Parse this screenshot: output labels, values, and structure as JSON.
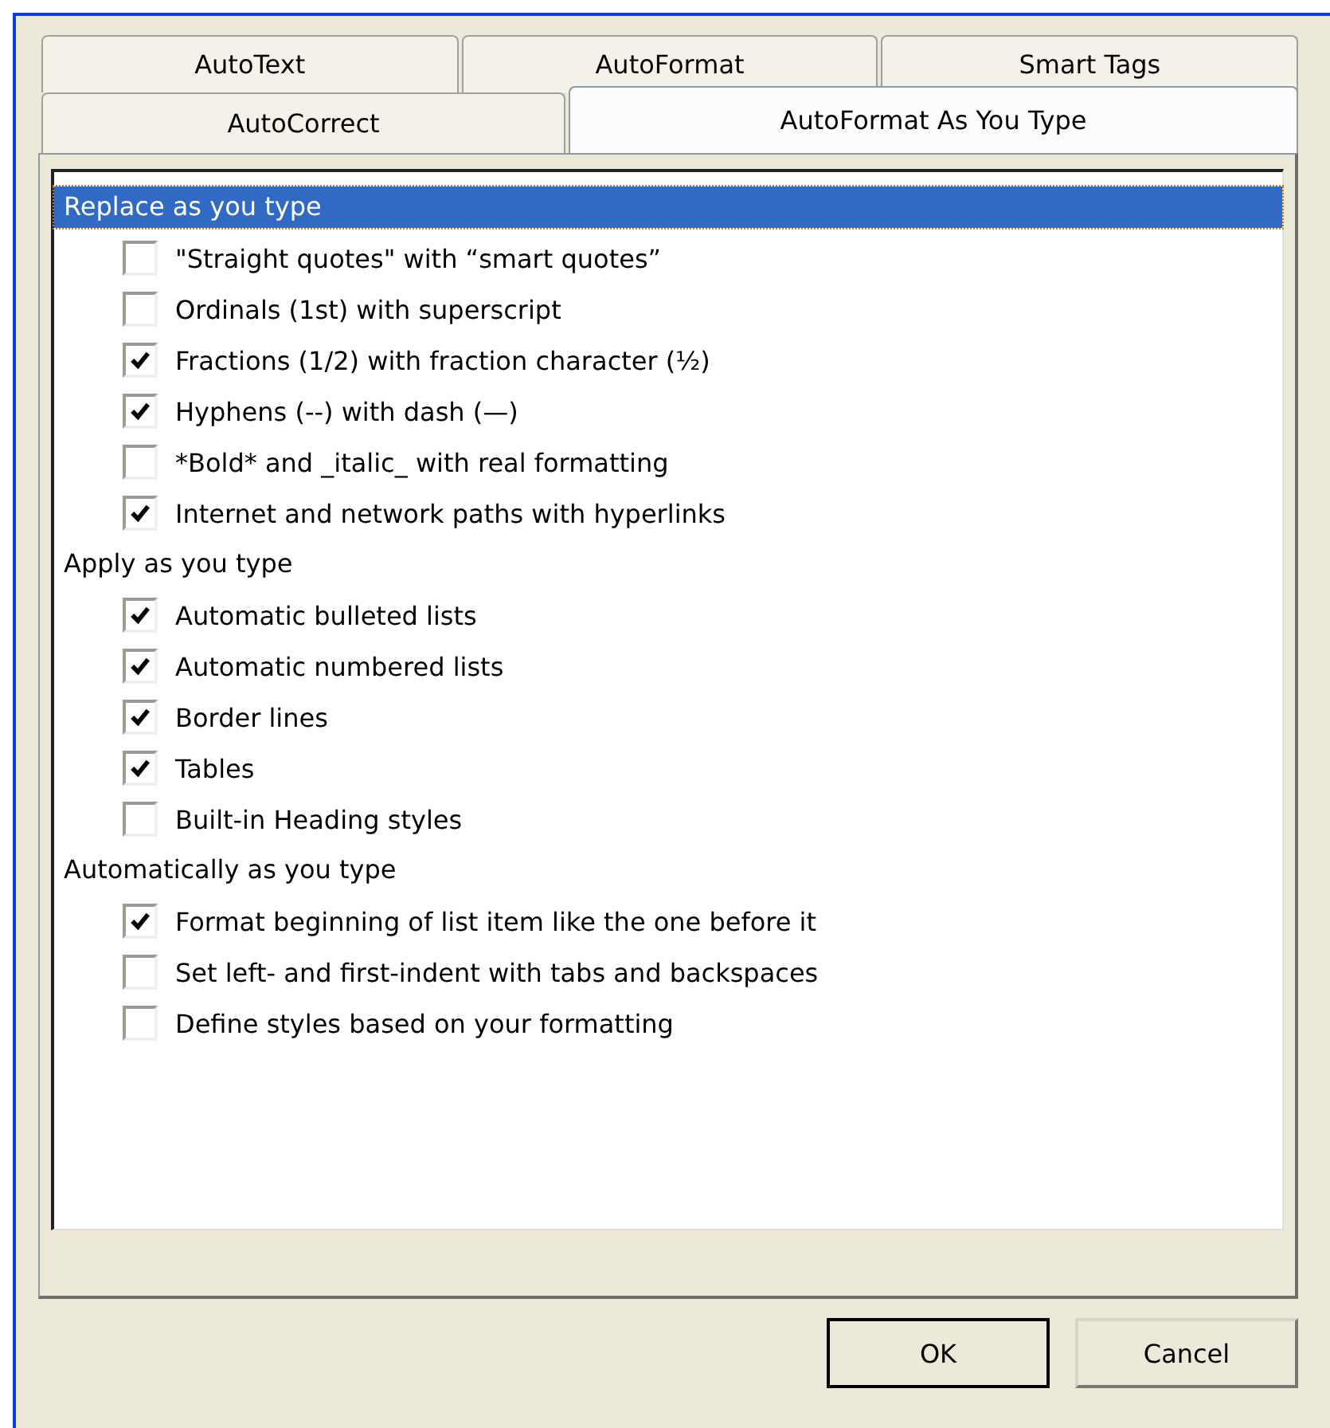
{
  "tab_rows": [
    {
      "tabs": [
        {
          "label": "AutoText",
          "selected": false
        },
        {
          "label": "AutoFormat",
          "selected": false
        },
        {
          "label": "Smart Tags",
          "selected": false
        }
      ]
    },
    {
      "tabs": [
        {
          "label": "AutoCorrect",
          "selected": false
        },
        {
          "label": "AutoFormat As You Type",
          "selected": true
        }
      ]
    }
  ],
  "groups": [
    {
      "heading": "Replace as you type",
      "selected": true,
      "options": [
        {
          "label": "\"Straight quotes\" with “smart quotes”",
          "checked": false
        },
        {
          "label": "Ordinals (1st) with superscript",
          "checked": false
        },
        {
          "label": "Fractions (1/2) with fraction character (½)",
          "checked": true
        },
        {
          "label": "Hyphens (--) with dash (—)",
          "checked": true
        },
        {
          "label": "*Bold* and _italic_ with real formatting",
          "checked": false
        },
        {
          "label": "Internet and network paths with hyperlinks",
          "checked": true
        }
      ]
    },
    {
      "heading": "Apply as you type",
      "selected": false,
      "options": [
        {
          "label": "Automatic bulleted lists",
          "checked": true
        },
        {
          "label": "Automatic numbered lists",
          "checked": true
        },
        {
          "label": "Border lines",
          "checked": true
        },
        {
          "label": "Tables",
          "checked": true
        },
        {
          "label": "Built-in Heading styles",
          "checked": false
        }
      ]
    },
    {
      "heading": "Automatically as you type",
      "selected": false,
      "options": [
        {
          "label": "Format beginning of list item like the one before it",
          "checked": true
        },
        {
          "label": "Set left- and first-indent with tabs and backspaces",
          "checked": false
        },
        {
          "label": "Define styles based on your formatting",
          "checked": false
        }
      ]
    }
  ],
  "buttons": [
    {
      "label": "OK",
      "default": true
    },
    {
      "label": "Cancel",
      "default": false
    }
  ]
}
